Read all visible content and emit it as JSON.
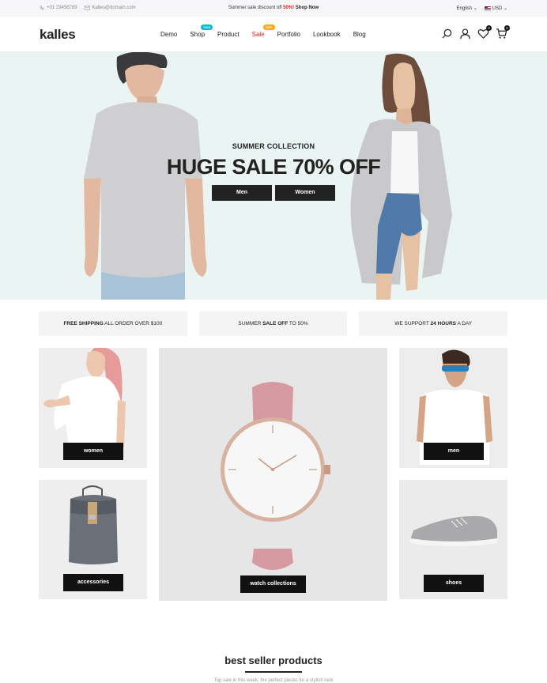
{
  "topbar": {
    "phone": "+01 23456789",
    "email": "Kalles@domain.com",
    "promo_text": "Summer sale discount off",
    "promo_percent": "50%!",
    "promo_link": "Shop Now",
    "language": "English",
    "currency": "USD"
  },
  "header": {
    "logo": "kalles",
    "nav": [
      {
        "label": "Demo"
      },
      {
        "label": "Shop",
        "badge": "New"
      },
      {
        "label": "Product"
      },
      {
        "label": "Sale",
        "badge": "Sale"
      },
      {
        "label": "Portfolio"
      },
      {
        "label": "Lookbook"
      },
      {
        "label": "Blog"
      }
    ],
    "wishlist_count": "0",
    "cart_count": "0"
  },
  "hero": {
    "subtitle": "SUMMER COLLECTION",
    "title": "HUGE SALE 70% OFF",
    "button_men": "Men",
    "button_women": "Women"
  },
  "services": [
    {
      "bold": "FREE SHIPPING",
      "rest": " ALL ORDER OVER $100",
      "prefix": ""
    },
    {
      "prefix": "SUMMER ",
      "bold": "SALE OFF",
      "rest": " TO 50%"
    },
    {
      "prefix": "WE SUPPORT ",
      "bold": "24 HOURS",
      "rest": " A DAY"
    }
  ],
  "categories": {
    "women": "women",
    "accessories": "accessories",
    "watch": "watch collections",
    "men": "men",
    "shoes": "shoes"
  },
  "section": {
    "heading": "best seller products",
    "subtext": "Top sale in this week, the perfect pieces for a stylish look"
  },
  "colors": {
    "accent_sale": "#e02020",
    "badge_new": "#01bad4",
    "badge_sale": "#ffa800",
    "hero_bg": "#eaf4f2"
  }
}
